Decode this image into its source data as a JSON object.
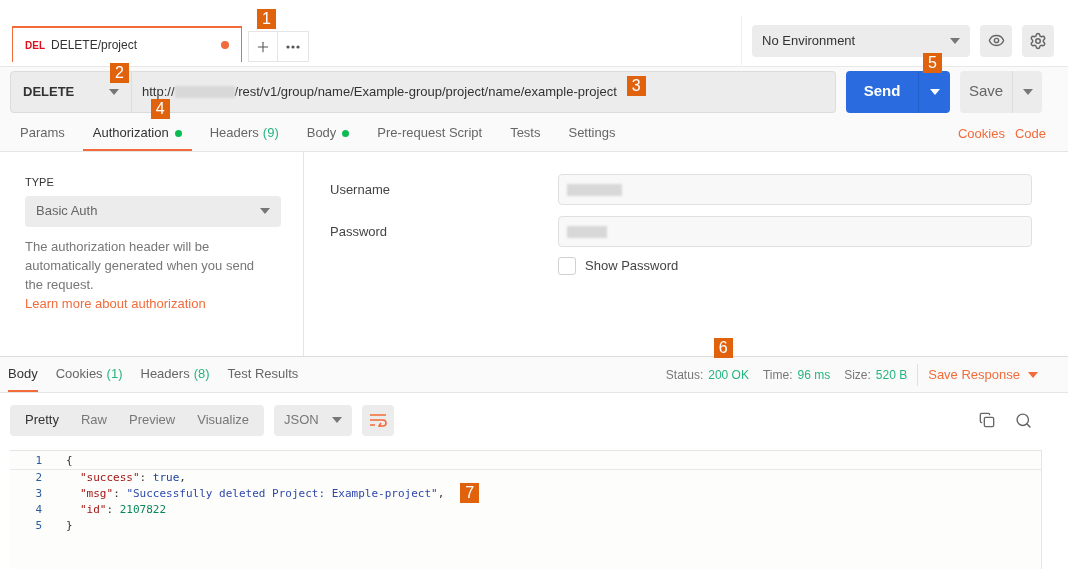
{
  "request_tab": {
    "method_badge": "DEL",
    "title": "DELETE/project",
    "unsaved": true
  },
  "new_tab": {
    "marker": "1"
  },
  "environment": {
    "label": "No Environment"
  },
  "request": {
    "method": "DELETE",
    "method_marker": "2",
    "url_prefix": "http://",
    "url_path": "/rest/v1/group/name/Example-group/project/name/example-project",
    "url_marker": "3",
    "send": "Send",
    "send_marker": "5",
    "save": "Save"
  },
  "request_tabs": [
    {
      "label": "Params",
      "selected": false,
      "dot": false
    },
    {
      "label": "Authorization",
      "selected": true,
      "dot": true,
      "marker": "4"
    },
    {
      "label": "Headers",
      "count": "(9)",
      "selected": false,
      "dot": false
    },
    {
      "label": "Body",
      "selected": false,
      "dot": true
    },
    {
      "label": "Pre-request Script",
      "selected": false,
      "dot": false
    },
    {
      "label": "Tests",
      "selected": false,
      "dot": false
    },
    {
      "label": "Settings",
      "selected": false,
      "dot": false
    }
  ],
  "request_links": [
    "Cookies",
    "Code"
  ],
  "auth": {
    "type_heading": "TYPE",
    "type": "Basic Auth",
    "description": "The authorization header will be automatically generated when you send the request.",
    "link": "Learn more about authorization",
    "fields": [
      {
        "label": "Username"
      },
      {
        "label": "Password"
      }
    ],
    "show_password": {
      "label": "Show Password",
      "checked": false
    }
  },
  "response_tabs": [
    {
      "label": "Body",
      "selected": true
    },
    {
      "label": "Cookies",
      "count": "(1)",
      "selected": false
    },
    {
      "label": "Headers",
      "count": "(8)",
      "selected": false
    },
    {
      "label": "Test Results",
      "selected": false
    }
  ],
  "status": {
    "marker": "6",
    "items": [
      {
        "label": "Status:",
        "value": "200 OK"
      },
      {
        "label": "Time:",
        "value": "96 ms"
      },
      {
        "label": "Size:",
        "value": "520 B"
      }
    ]
  },
  "save_response": "Save Response",
  "view_modes": [
    {
      "label": "Pretty",
      "selected": true
    },
    {
      "label": "Raw",
      "selected": false
    },
    {
      "label": "Preview",
      "selected": false
    },
    {
      "label": "Visualize",
      "selected": false
    }
  ],
  "format": "JSON",
  "code": [
    {
      "number": "1",
      "tokens": [
        {
          "kind": "punct",
          "text": "{"
        }
      ]
    },
    {
      "number": "2",
      "tokens": [
        {
          "kind": "key",
          "text": "\"success\""
        },
        {
          "kind": "punct",
          "text": ": "
        },
        {
          "kind": "literal",
          "text": "true"
        },
        {
          "kind": "punct",
          "text": ","
        }
      ]
    },
    {
      "number": "3",
      "tokens": [
        {
          "kind": "key",
          "text": "\"msg\""
        },
        {
          "kind": "punct",
          "text": ": "
        },
        {
          "kind": "string",
          "text": "\"Successfully deleted Project: Example-project\""
        },
        {
          "kind": "punct",
          "text": ","
        }
      ],
      "marker": "7"
    },
    {
      "number": "4",
      "tokens": [
        {
          "kind": "key",
          "text": "\"id\""
        },
        {
          "kind": "punct",
          "text": ": "
        },
        {
          "kind": "number",
          "text": "2107822"
        }
      ]
    },
    {
      "number": "5",
      "tokens": [
        {
          "kind": "punct",
          "text": "}"
        }
      ]
    }
  ]
}
